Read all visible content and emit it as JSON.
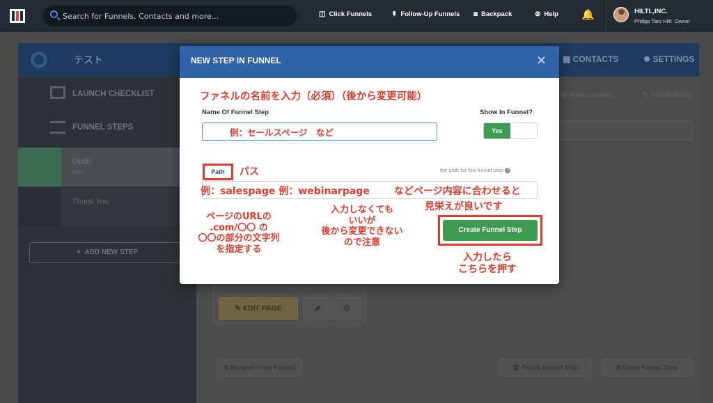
{
  "topbar": {
    "search_placeholder": "Search for Funnels, Contacts and more...",
    "nav": [
      {
        "icon": "click-funnels-icon",
        "label": "Click Funnels"
      },
      {
        "icon": "double-chevron-up-icon",
        "label": "Follow-Up Funnels"
      },
      {
        "icon": "backpack-icon",
        "label": "Backpack"
      },
      {
        "icon": "help-icon",
        "label": "Help"
      }
    ],
    "account_name": "HILTL,INC.",
    "account_user": "Philipp Taro Hiltl",
    "account_role": "Owner"
  },
  "funnel": {
    "title": "テスト",
    "tabs": {
      "contacts": "CONTACTS",
      "settings": "SETTINGS"
    },
    "subtabs": {
      "automation": "Automation",
      "publishing": "Publishing"
    }
  },
  "sidebar": {
    "launch_checklist": "LAUNCH CHECKLIST",
    "funnel_steps": "FUNNEL STEPS",
    "steps": [
      {
        "name": "Optin",
        "sub": "Optin"
      },
      {
        "name": "Thank You",
        "sub": ""
      }
    ],
    "add_step": "ADD NEW STEP"
  },
  "step_panel": {
    "edit_page": "EDIT PAGE",
    "remove": "Remove From Funnel",
    "delete": "Delete Funnel Step",
    "clone": "Clone Funnel Step"
  },
  "modal": {
    "title": "NEW STEP IN FUNNEL",
    "close": "×",
    "name_label": "Name Of Funnel Step",
    "show_label": "Show In Funnel?",
    "toggle_on": "Yes",
    "path_label": "Path",
    "path_hint": "the path for this funnel step",
    "create_button": "Create Funnel Step"
  },
  "annotations": {
    "name_note": "ファネルの名前を入力（必須）（後から変更可能）",
    "name_example": "例：セールスページ　など",
    "path_note": "パス",
    "path_example": "例：salespage 例：webinarpage",
    "path_example_2": "などページ内容に合わせると",
    "path_example_3": "見栄えが良いです",
    "url_note": [
      "ページのURLの",
      ".com/〇〇 の",
      "〇〇の部分の文字列",
      "を指定する"
    ],
    "optional_note": [
      "入力しなくても",
      "いいが",
      "後から変更できない",
      "ので注意"
    ],
    "press_note": [
      "入力したら",
      "こちらを押す"
    ]
  },
  "colors": {
    "topbar": "#232a33",
    "modal_header": "#2f63a6",
    "primary_green": "#3f9a52",
    "annotation_red": "#e03b2c"
  }
}
